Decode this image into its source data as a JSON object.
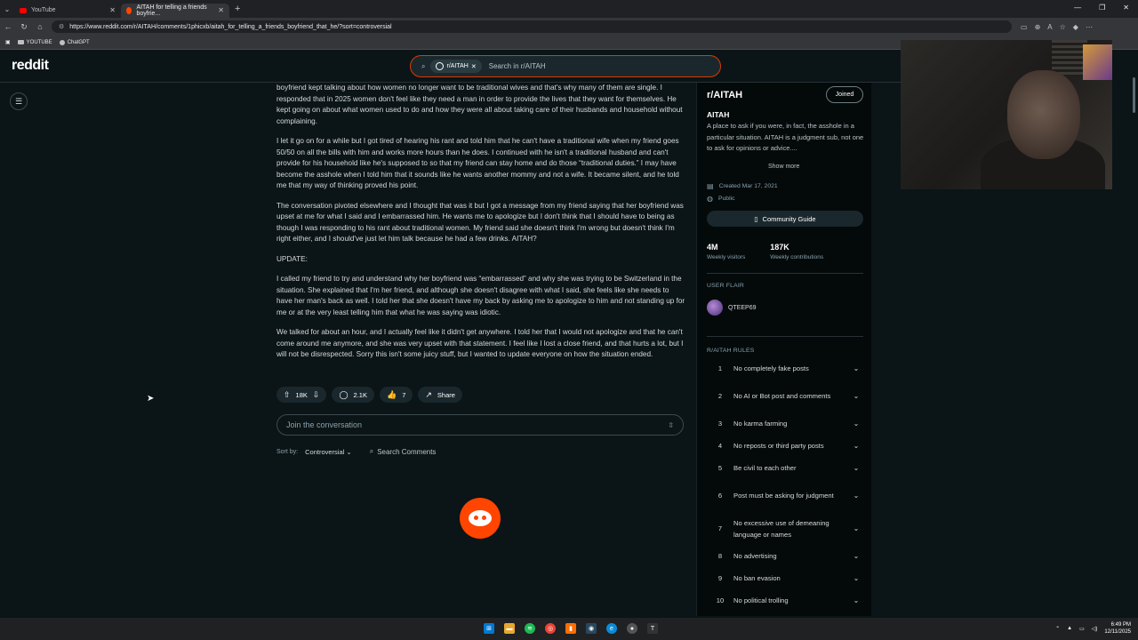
{
  "browser": {
    "tabs": [
      {
        "title": "YouTube",
        "active": false
      },
      {
        "title": "AITAH for telling a friends boyfrie...",
        "active": true
      }
    ],
    "url": "https://www.reddit.com/r/AITAH/comments/1phicxb/aitah_for_telling_a_friends_boyfriend_that_he/?sort=controversial",
    "bookmarks": [
      "YOUTUBE",
      "ChatGPT"
    ]
  },
  "header": {
    "logo": "reddit",
    "search_chip": "r/AITAH",
    "search_placeholder": "Search in r/AITAH"
  },
  "post": {
    "paragraphs": [
      "boyfriend kept talking about how women no longer want to be traditional wives and that's why many of them are single. I responded that in 2025 women don't feel like they need a man in order to provide the lives that they want for themselves. He kept going on about what women used to do and how they were all about taking care of their husbands and household without complaining.",
      "I let it go on for a while but I got tired of hearing his rant and told him that he can't have a traditional wife when my friend goes 50/50 on all the bills with him and works more hours than he does. I continued with he isn't a traditional husband and can't provide for his household like he's supposed to so that my friend can stay home and do those “traditional duties.” I may have become the asshole when I told him that it sounds like he wants another mommy and not a wife. It became silent, and he told me that my way of thinking proved his point.",
      "The conversation pivoted elsewhere and I thought that was it but I got a message from my friend saying that her boyfriend was upset at me for what I said and I embarrassed him. He wants me to apologize but I don't think that I should have to being as though I was responding to his rant about traditional women. My friend said she doesn't think I'm wrong but doesn't think I'm right either, and I should've just let him talk because he had a few drinks. AITAH?",
      "UPDATE:",
      "I called my friend to try and understand why her boyfriend was “embarrassed” and why she was trying to be Switzerland in the situation. She explained that I'm her friend, and although she doesn't disagree with what I said, she feels like she needs to have her man's back as well. I told her that she doesn't have my back by asking me to apologize to him and not standing up for me or at the very least telling him that what he was saying was idiotic.",
      "We talked for about an hour, and I actually feel like it didn't get anywhere. I told her that I would not apologize and that he can't come around me anymore, and she was very upset with that statement. I feel like I lost a close friend, and that hurts a lot, but I will not be disrespected. Sorry this isn't some juicy stuff, but I wanted to update everyone on how the situation ended."
    ],
    "votes": "18K",
    "comments": "2.1K",
    "awards": "7",
    "share_label": "Share"
  },
  "comments": {
    "join_placeholder": "Join the conversation",
    "sort_label": "Sort by:",
    "sort_value": "Controversial",
    "search_label": "Search Comments"
  },
  "sidebar": {
    "sub_title": "r/AITAH",
    "joined_label": "Joined",
    "name": "AITAH",
    "description": "A place to ask if you were, in fact, the asshole in a particular situation. AITAH is a judgment sub, not one to ask for opinions or advice....",
    "show_more": "Show more",
    "created": "Created Mar 17, 2021",
    "visibility": "Public",
    "guide_label": "Community Guide",
    "stats": [
      {
        "value": "4M",
        "label": "Weekly visitors"
      },
      {
        "value": "187K",
        "label": "Weekly contributions"
      }
    ],
    "user_flair_title": "USER FLAIR",
    "user_flair_name": "QTEEP69",
    "rules_title": "R/AITAH RULES",
    "rules": [
      {
        "num": "1",
        "text": "No completely fake posts"
      },
      {
        "num": "2",
        "text": "No AI or Bot post and comments"
      },
      {
        "num": "3",
        "text": "No karma farming"
      },
      {
        "num": "4",
        "text": "No reposts or third party posts"
      },
      {
        "num": "5",
        "text": "Be civil to each other"
      },
      {
        "num": "6",
        "text": "Post must be asking for judgment"
      },
      {
        "num": "7",
        "text": "No excessive use of demeaning language or names"
      },
      {
        "num": "8",
        "text": "No advertising"
      },
      {
        "num": "9",
        "text": "No ban evasion"
      },
      {
        "num": "10",
        "text": "No political trolling"
      }
    ]
  },
  "taskbar": {
    "time": "6:49 PM",
    "date": "12/11/2025"
  },
  "colors": {
    "background": "#0b1416",
    "accent": "#ff4500",
    "search_border": "#d93a00"
  }
}
